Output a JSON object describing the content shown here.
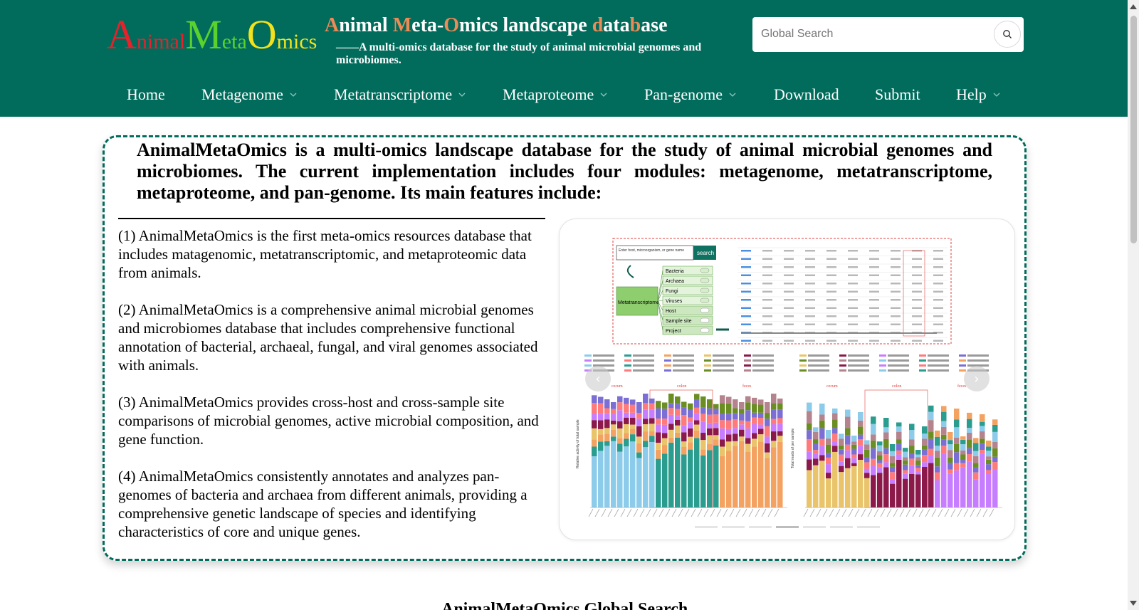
{
  "header": {
    "logo": {
      "parts": [
        {
          "text": "A",
          "size": "big",
          "color": "#e8212a"
        },
        {
          "text": "nimal",
          "size": "small",
          "color": "#e8212a"
        },
        {
          "text": "M",
          "size": "big",
          "color": "#5ad12c"
        },
        {
          "text": "eta",
          "size": "small",
          "color": "#5ad12c"
        },
        {
          "text": "O",
          "size": "big",
          "color": "#f3e21b"
        },
        {
          "text": "mics",
          "size": "small",
          "color": "#f3e21b"
        }
      ]
    },
    "title_parts": [
      {
        "text": "A",
        "hl": true
      },
      {
        "text": "nimal ",
        "hl": false
      },
      {
        "text": "M",
        "hl": true
      },
      {
        "text": "eta-",
        "hl": false
      },
      {
        "text": "O",
        "hl": true
      },
      {
        "text": "mics landscape ",
        "hl": false
      },
      {
        "text": "d",
        "hl": true
      },
      {
        "text": "ata",
        "hl": false
      },
      {
        "text": "b",
        "hl": true
      },
      {
        "text": "ase",
        "hl": false
      }
    ],
    "subtitle": "——A multi-omics database for the study of animal microbial genomes and microbiomes.",
    "search": {
      "placeholder": "Global Search",
      "icon": "search-icon"
    }
  },
  "nav": [
    {
      "label": "Home",
      "dropdown": false
    },
    {
      "label": "Metagenome",
      "dropdown": true
    },
    {
      "label": "Metatranscriptome",
      "dropdown": true
    },
    {
      "label": "Metaproteome",
      "dropdown": true
    },
    {
      "label": "Pan-genome",
      "dropdown": true
    },
    {
      "label": "Download",
      "dropdown": false
    },
    {
      "label": "Submit",
      "dropdown": false
    },
    {
      "label": "Help",
      "dropdown": true
    }
  ],
  "intro": "AnimalMetaOmics is a multi-omics landscape database for the study of animal microbial genomes and microbiomes. The current implementation includes four modules: metagenome, metatranscriptome, metaproteome, and pan-genome. Its main features include:",
  "features": [
    "(1) AnimalMetaOmics is the first meta-omics resources database that includes matagenomic, metatranscriptomic, and metaproteomic data from animals.",
    "(2) AnimalMetaOmics is a comprehensive animal microbial genomes and microbiomes database that includes comprehensive functional annotation of bacterial, archaeal, fungal, and viral genomes associated with animals.",
    "(3) AnimalMetaOmics provides cross-host and cross-sample site comparisons of microbial genomes, active microbial composition, and gene function.",
    "(4) AnimalMetaOmics consistently annotates and analyzes pan-genomes of bacteria and archaea from different animals, providing a comprehensive genetic landscape of species and identifying characteristics of core and unique genes."
  ],
  "carousel": {
    "prev_icon": "chevron-left-icon",
    "next_icon": "chevron-right-icon",
    "prev_glyph": "‹",
    "next_glyph": "›",
    "slide_count": 7,
    "active_slide": 4,
    "slide": {
      "search_placeholder": "Enter host, microorganism, or gene name e.g. Callithrix Jacchus",
      "search_button": "search",
      "module": "Metatranscriptome",
      "categories": [
        "Bacteria",
        "Archaea",
        "Fungi",
        "Viruses",
        "Host",
        "Sample site",
        "Project"
      ],
      "chart1_ylabel": "Relative activity of total sample",
      "chart2_ylabel": "Total reads of per sample",
      "groups": [
        "cecum",
        "colon",
        "feces"
      ]
    }
  },
  "below_title": "AnimalMetaOmics Global Search"
}
